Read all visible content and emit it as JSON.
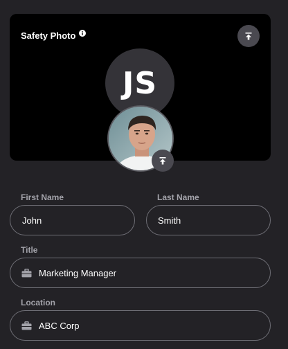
{
  "photo_card": {
    "title": "Safety Photo",
    "initials": "JS"
  },
  "form": {
    "first_name": {
      "label": "First Name",
      "value": "John"
    },
    "last_name": {
      "label": "Last Name",
      "value": "Smith"
    },
    "title": {
      "label": "Title",
      "value": "Marketing Manager"
    },
    "location": {
      "label": "Location",
      "value": "ABC Corp"
    }
  },
  "icons": {
    "info": "info-icon",
    "upload": "upload-icon",
    "briefcase": "briefcase-icon"
  },
  "colors": {
    "background": "#232226",
    "card": "#000000",
    "initials_bg": "#343338",
    "button_bg": "#4a4950",
    "field_border": "#6f6f76",
    "label": "#a3a3aa"
  }
}
